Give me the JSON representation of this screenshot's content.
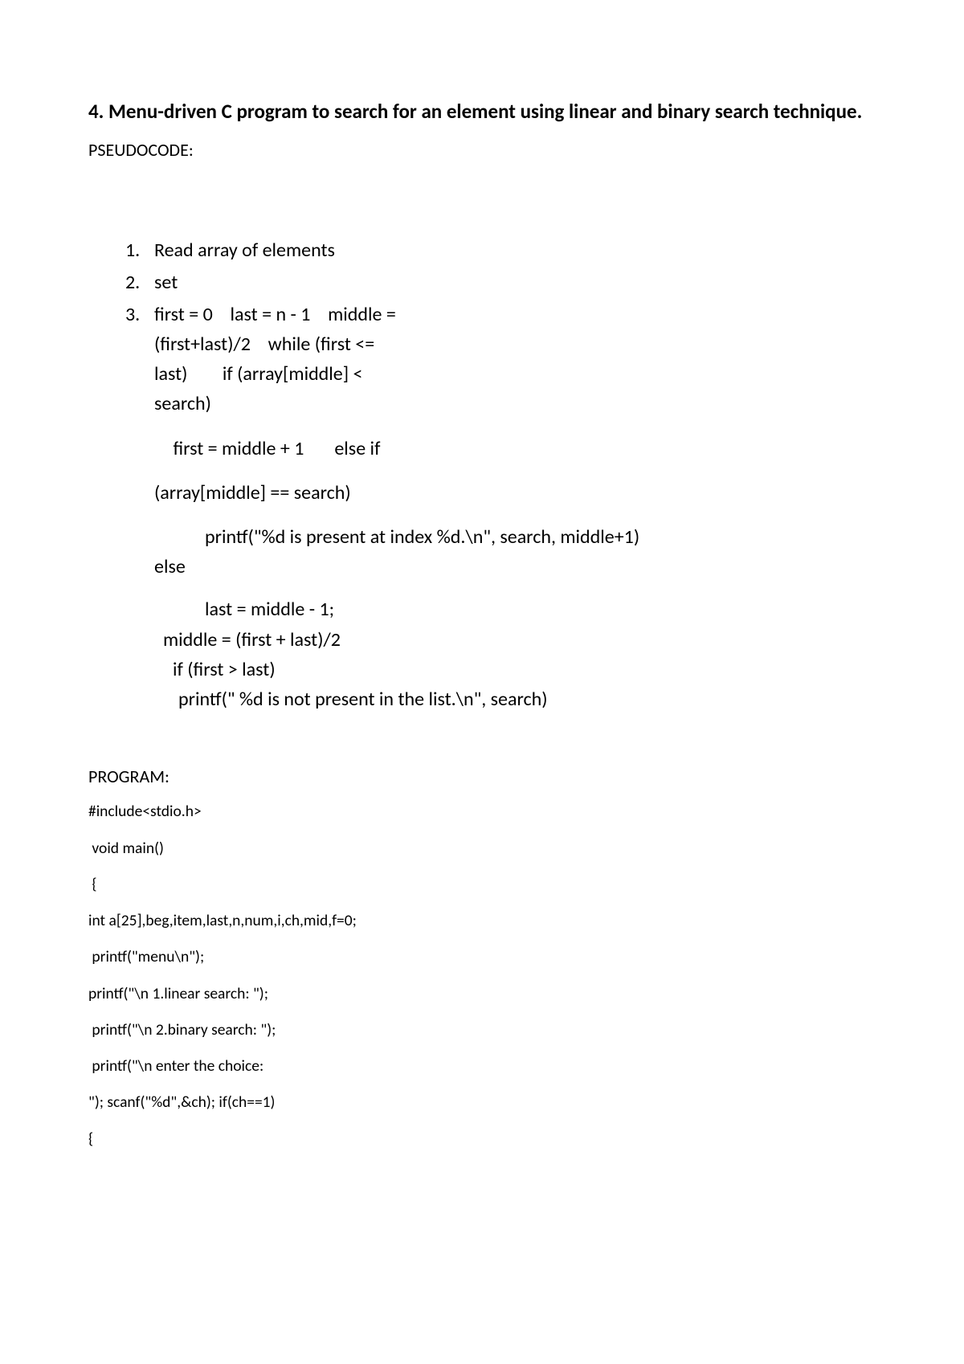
{
  "title": "4. Menu-driven C program to search for an element using linear and binary search technique.",
  "pseudocode_label": "PSEUDOCODE:",
  "list_items": {
    "item1_marker": "1.",
    "item1_text": "Read array of elements",
    "item2_marker": "2.",
    "item2_text": "set",
    "item3_marker": "3.",
    "item3_line1": "first = 0    last = n - 1    middle =",
    "item3_line2": "(first+last)/2    while (first <=",
    "item3_line3": "last)        if (array[middle] <",
    "item3_line4": "search)",
    "item3_sub1": " first = middle + 1       else if",
    "item3_sub2": "(array[middle] == search)",
    "item3_printf": "printf(\"%d is present at index %d.\\n\", search, middle+1)",
    "item3_else": "else",
    "item3_last": "last = middle - 1;",
    "item3_middle": "middle = (first + last)/2",
    "item3_if2": "if (first > last)",
    "item3_printf2": "printf(\" %d is not present in the list.\\n\", search)"
  },
  "program_label": "PROGRAM:",
  "code_lines": {
    "l1": "#include<stdio.h>",
    "l2": " void main()",
    "l3": " {",
    "l4": "int a[25],beg,item,last,n,num,i,ch,mid,f=0;",
    "l5": " printf(\"menu\\n\");",
    "l6": "printf(\"\\n 1.linear search: \");",
    "l7": " printf(\"\\n 2.binary search: \");",
    "l8": " printf(\"\\n enter the choice:",
    "l9": "\"); scanf(\"%d\",&ch); if(ch==1)",
    "l10": "{"
  }
}
